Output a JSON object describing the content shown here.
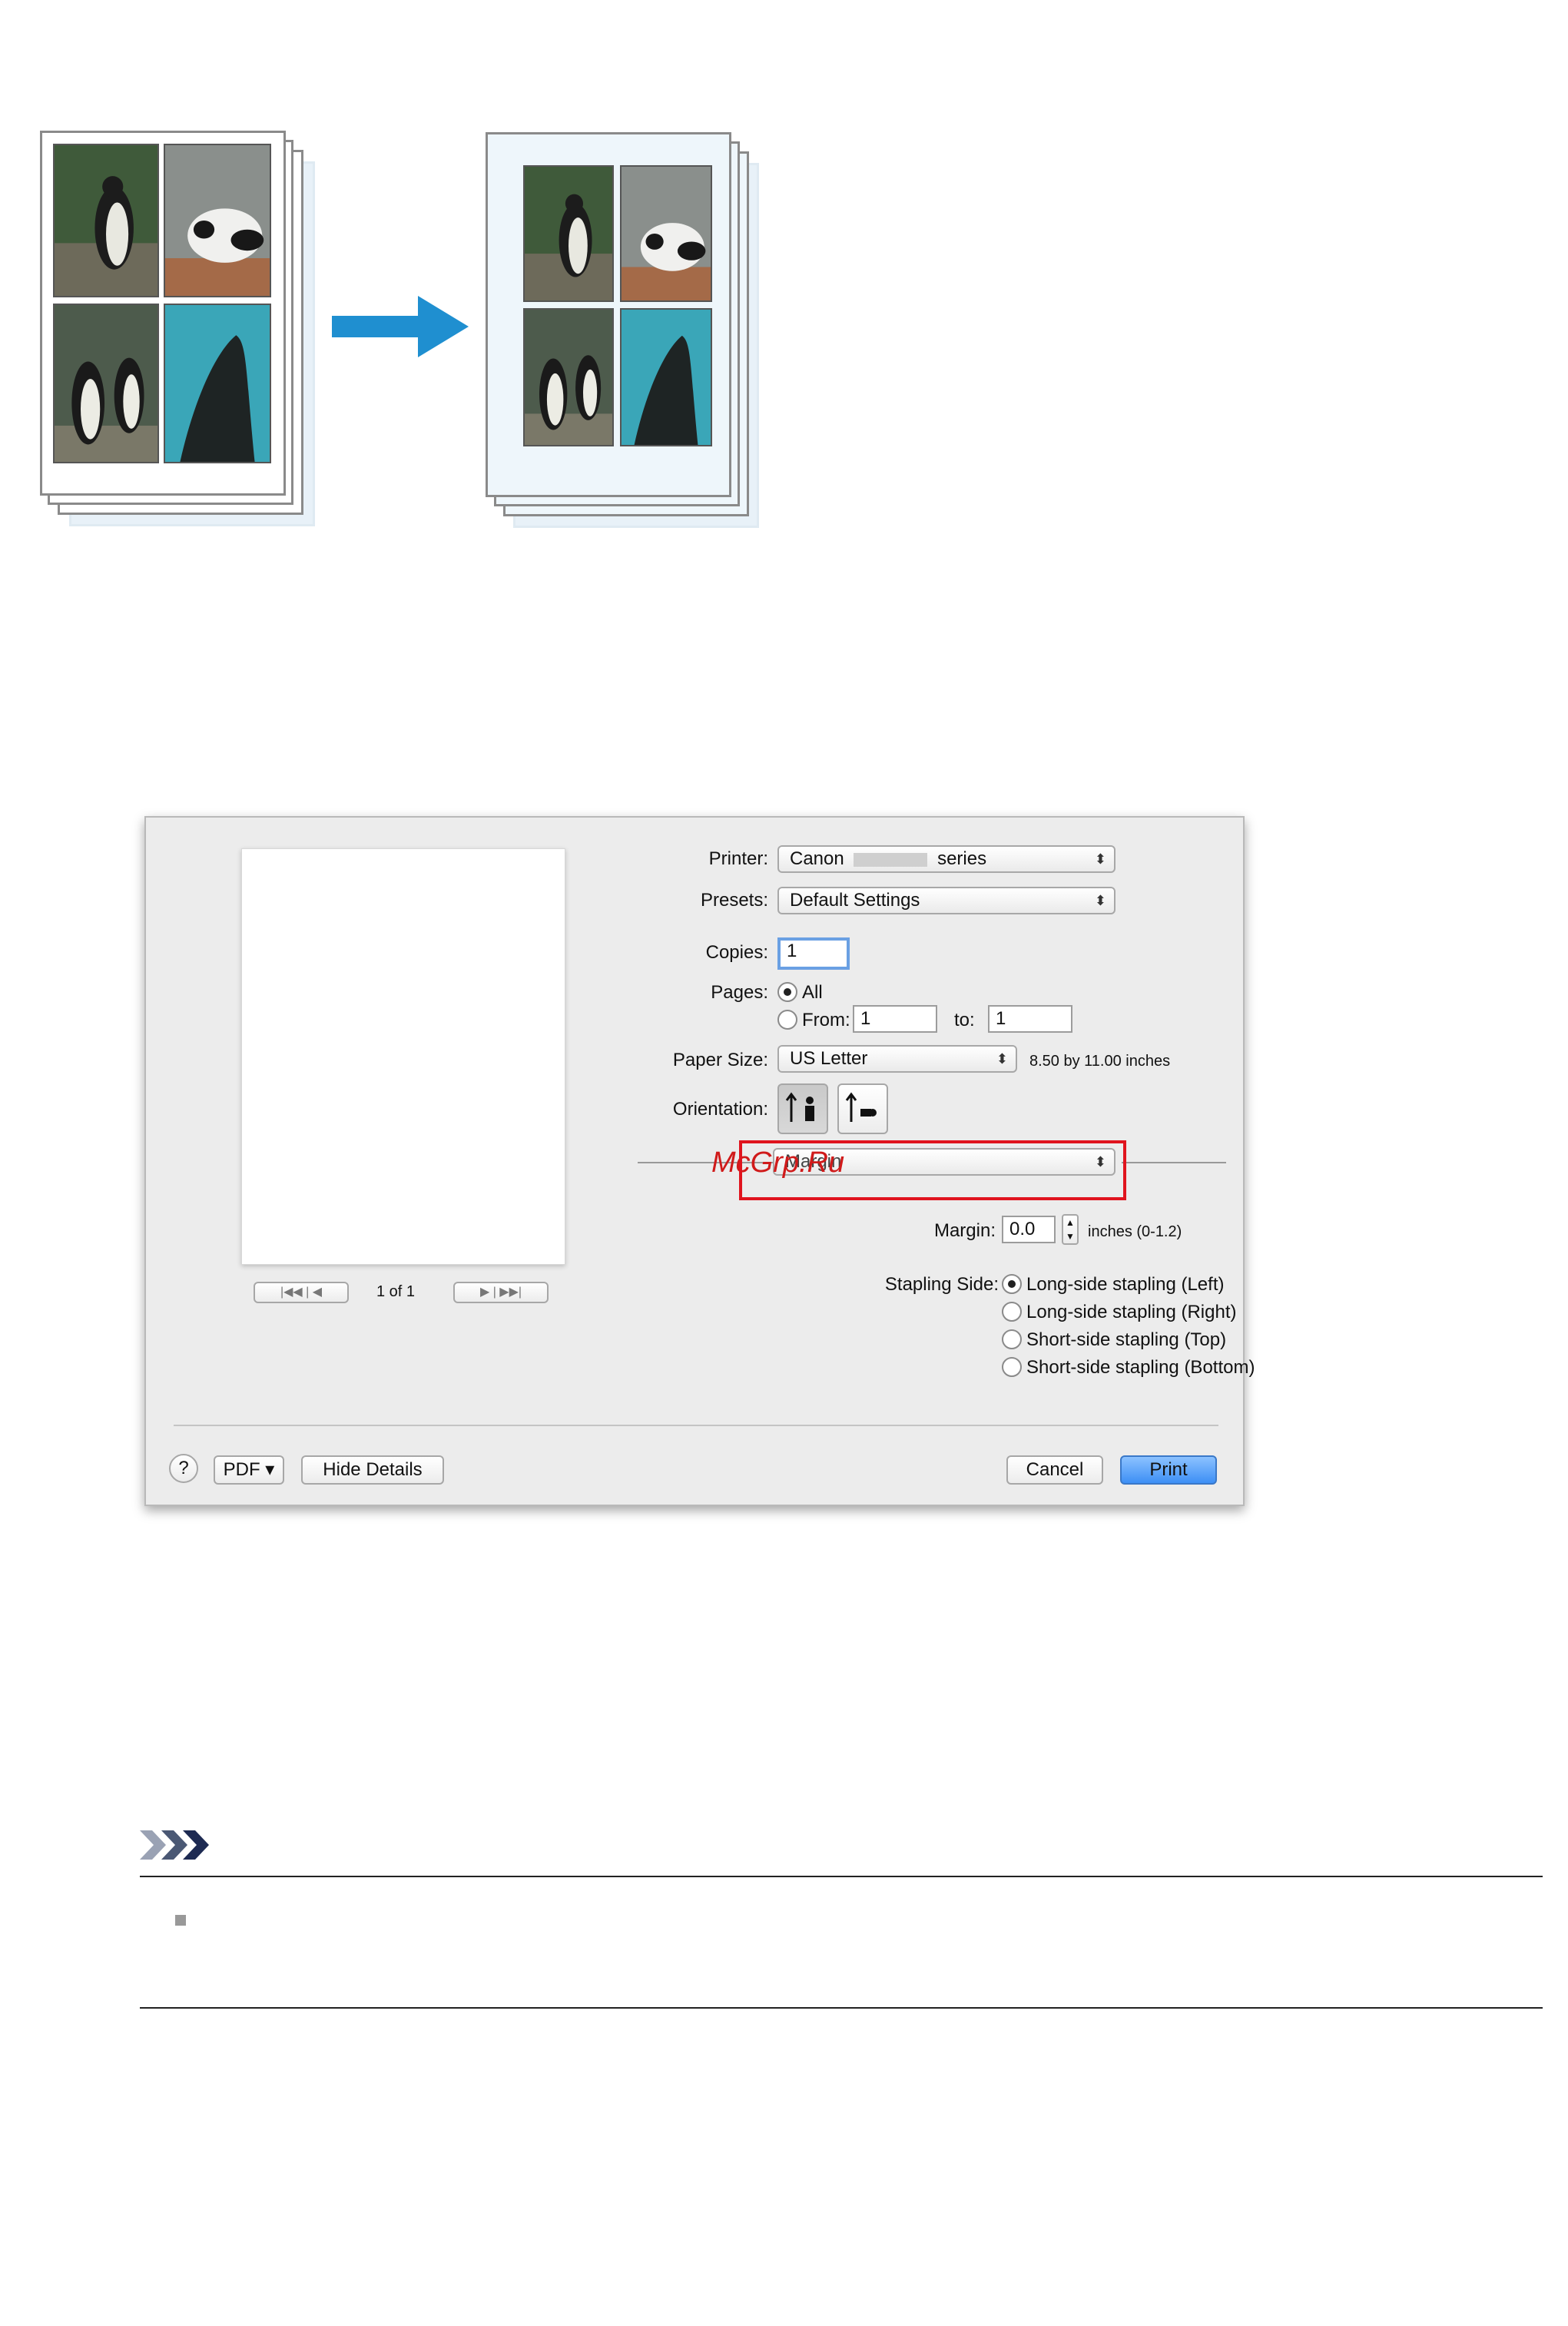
{
  "dialog": {
    "printer": {
      "label": "Printer:",
      "value_prefix": "Canon",
      "value_suffix": "series"
    },
    "presets": {
      "label": "Presets:",
      "value": "Default Settings"
    },
    "copies": {
      "label": "Copies:",
      "value": "1"
    },
    "pages": {
      "label": "Pages:",
      "all_label": "All",
      "from_label": "From:",
      "from_value": "1",
      "to_label": "to:",
      "to_value": "1"
    },
    "paper_size": {
      "label": "Paper Size:",
      "value": "US Letter",
      "dimensions": "8.50 by 11.00 inches"
    },
    "orientation": {
      "label": "Orientation:"
    },
    "section_popup": {
      "value": "Margin"
    },
    "watermark": "McGrp.Ru",
    "margin": {
      "label": "Margin:",
      "value": "0.0",
      "unit": "inches (0-1.2)"
    },
    "stapling": {
      "label": "Stapling Side:",
      "options": [
        "Long-side stapling (Left)",
        "Long-side stapling (Right)",
        "Short-side stapling (Top)",
        "Short-side stapling (Bottom)"
      ]
    },
    "preview": {
      "page_indicator": "1 of 1"
    },
    "footer": {
      "help_label": "?",
      "pdf_label": "PDF ▾",
      "hide_details_label": "Hide Details",
      "cancel_label": "Cancel",
      "print_label": "Print"
    }
  },
  "colors": {
    "arrow": "#1f8fd0",
    "highlight": "#e0141e",
    "watermark": "#d01a1a"
  },
  "icons": {
    "note": "note-chevrons-icon",
    "bullet": "square-bullet-icon"
  }
}
